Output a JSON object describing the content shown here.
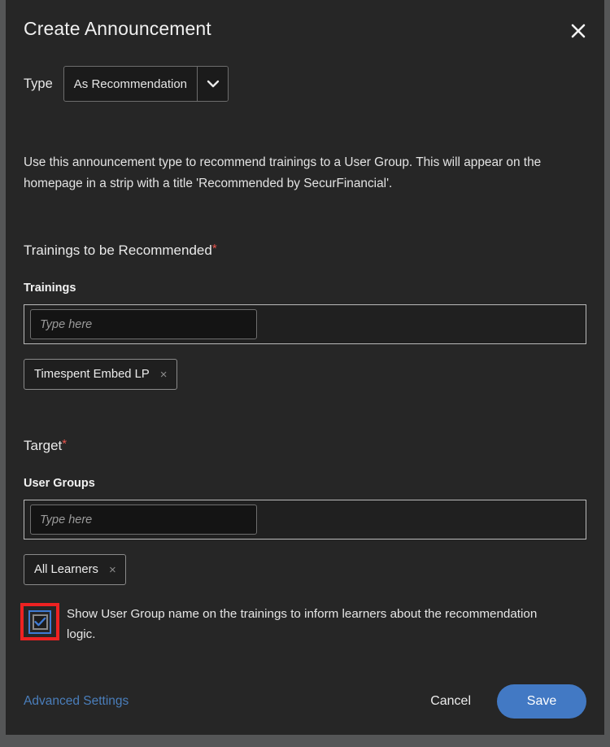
{
  "dialog": {
    "title": "Create Announcement",
    "close_icon": "close-icon"
  },
  "type_field": {
    "label": "Type",
    "selected_value": "As Recommendation",
    "chevron_icon": "chevron-down-icon"
  },
  "description": "Use this announcement type to recommend trainings to a User Group. This will appear on the homepage in a strip with a title 'Recommended by SecurFinancial'.",
  "trainings_section": {
    "section_title": "Trainings to be Recommended",
    "required_marker": "*",
    "field_label": "Trainings",
    "input_placeholder": "Type here",
    "input_value": "",
    "chips": [
      {
        "label": "Timespent Embed LP",
        "remove_icon": "close-icon",
        "remove_glyph": "×"
      }
    ]
  },
  "target_section": {
    "section_title": "Target",
    "required_marker": "*",
    "field_label": "User Groups",
    "input_placeholder": "Type here",
    "input_value": "",
    "chips": [
      {
        "label": "All Learners",
        "remove_icon": "close-icon",
        "remove_glyph": "×"
      }
    ]
  },
  "show_group_name_checkbox": {
    "label": "Show User Group name on the trainings to inform learners about the recommendation logic.",
    "checked": true,
    "check_icon": "checkmark-icon",
    "highlight_color": "#ee2222",
    "focus_color": "#3f7bd4"
  },
  "footer": {
    "advanced_settings_label": "Advanced Settings",
    "cancel_label": "Cancel",
    "save_label": "Save",
    "link_color": "#4a7ebb",
    "primary_color": "#4279c4"
  }
}
